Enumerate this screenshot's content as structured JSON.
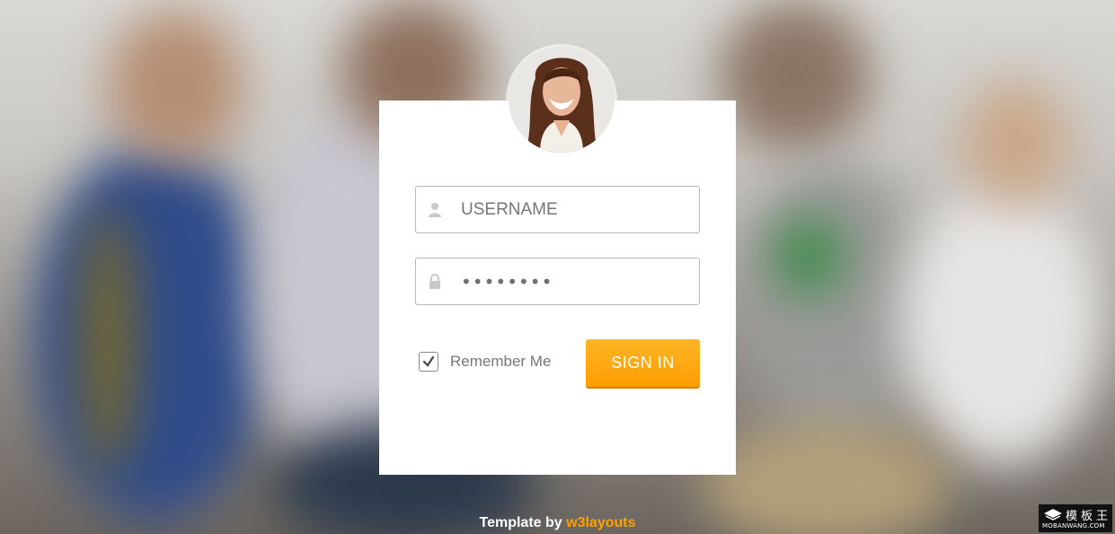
{
  "login": {
    "username_placeholder": "USERNAME",
    "password_value": "••••••••",
    "remember_label": "Remember Me",
    "remember_checked": true,
    "signin_label": "SIGN IN"
  },
  "footer": {
    "prefix": "Template by ",
    "brand": "w3layouts"
  },
  "watermark": {
    "title": "模板王",
    "url": "MOBANWANG.COM"
  },
  "colors": {
    "accent": "#ff9f00",
    "card": "#ffffff",
    "text_muted": "#777777"
  },
  "icons": {
    "username": "user-icon",
    "password": "lock-icon",
    "checkbox": "checkmark-icon"
  }
}
